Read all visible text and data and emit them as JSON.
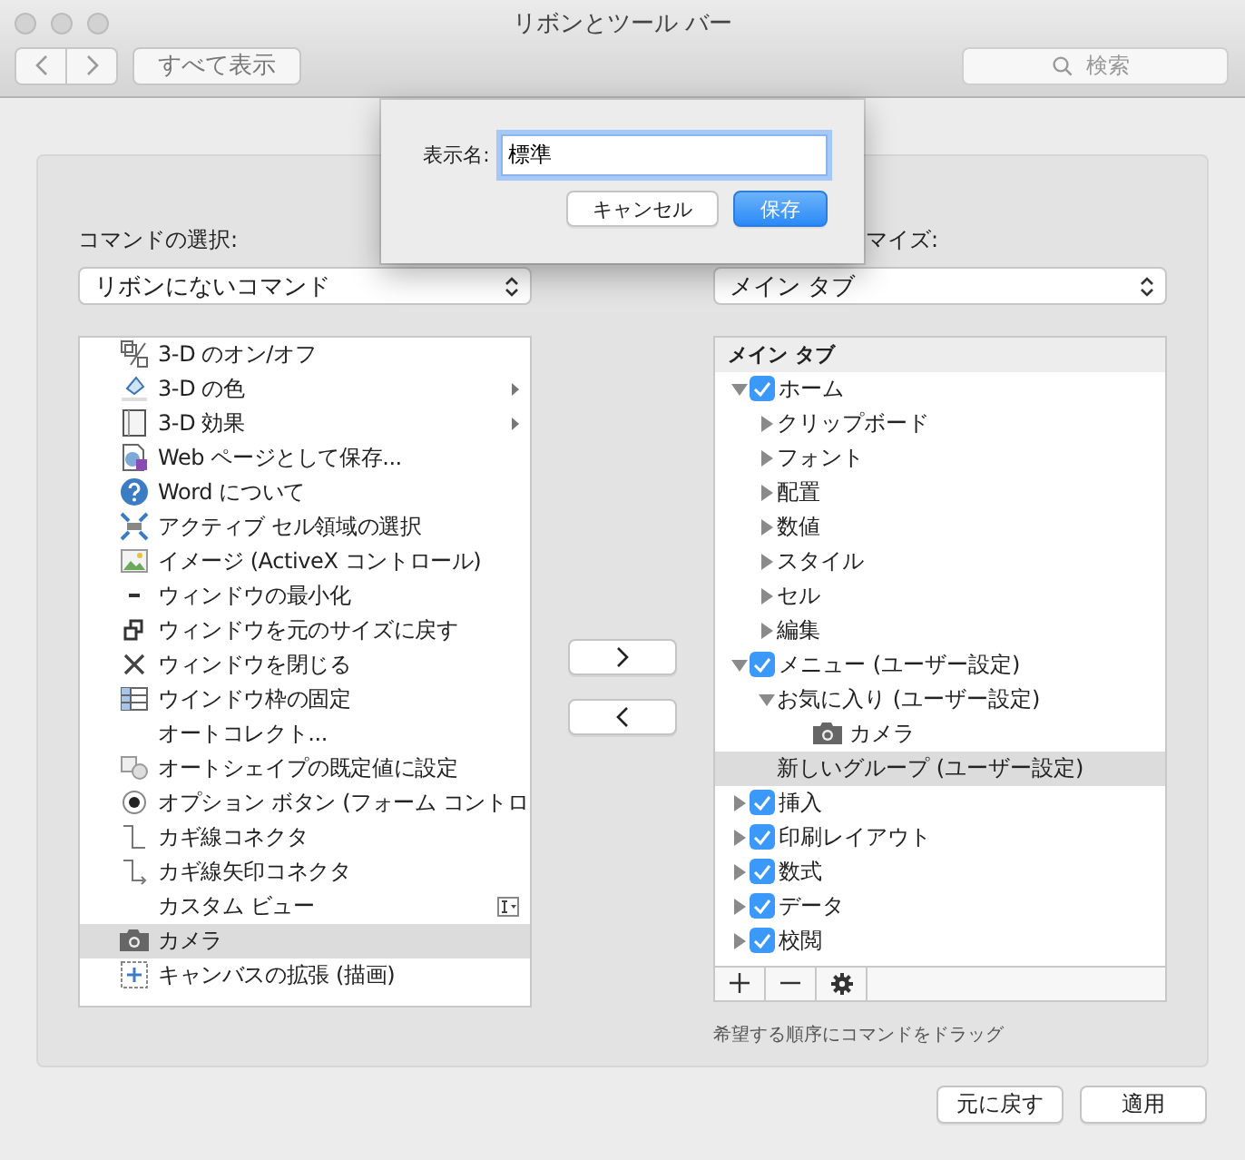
{
  "window": {
    "title": "リボンとツール バー"
  },
  "toolbar": {
    "show_all": "すべて表示",
    "search": {
      "placeholder": "検索"
    }
  },
  "commands": {
    "label": "コマンドの選択:",
    "dropdown": "リボンにないコマンド",
    "items": [
      {
        "label": "3-D のオン/オフ",
        "submenu": false,
        "selected": false
      },
      {
        "label": "3-D の色",
        "submenu": true,
        "selected": false
      },
      {
        "label": "3-D 効果",
        "submenu": true,
        "selected": false
      },
      {
        "label": "Web ページとして保存...",
        "submenu": false,
        "selected": false
      },
      {
        "label": "Word について",
        "submenu": false,
        "selected": false
      },
      {
        "label": "アクティブ セル領域の選択",
        "submenu": false,
        "selected": false
      },
      {
        "label": "イメージ (ActiveX コントロール)",
        "submenu": false,
        "selected": false
      },
      {
        "label": "ウィンドウの最小化",
        "submenu": false,
        "selected": false
      },
      {
        "label": "ウィンドウを元のサイズに戻す",
        "submenu": false,
        "selected": false
      },
      {
        "label": "ウィンドウを閉じる",
        "submenu": false,
        "selected": false
      },
      {
        "label": "ウインドウ枠の固定",
        "submenu": false,
        "selected": false
      },
      {
        "label": "オートコレクト...",
        "submenu": false,
        "selected": false
      },
      {
        "label": "オートシェイプの既定値に設定",
        "submenu": false,
        "selected": false
      },
      {
        "label": "オプション ボタン (フォーム コントロ",
        "submenu": false,
        "selected": false
      },
      {
        "label": "カギ線コネクタ",
        "submenu": false,
        "selected": false
      },
      {
        "label": "カギ線矢印コネクタ",
        "submenu": false,
        "selected": false
      },
      {
        "label": "カスタム ビュー",
        "submenu": false,
        "selected": false
      },
      {
        "label": "カメラ",
        "submenu": false,
        "selected": true
      },
      {
        "label": "キャンバスの拡張 (描画)",
        "submenu": false,
        "selected": false
      }
    ]
  },
  "customize": {
    "label": "マイズ:",
    "dropdown": "メイン タブ",
    "tree_header": "メイン タブ",
    "tree": [
      {
        "kind": "tab",
        "label": "ホーム",
        "checked": true,
        "expanded": true,
        "selected": false,
        "children": [
          {
            "kind": "group",
            "label": "クリップボード",
            "expanded": false,
            "selected": false
          },
          {
            "kind": "group",
            "label": "フォント",
            "expanded": false,
            "selected": false
          },
          {
            "kind": "group",
            "label": "配置",
            "expanded": false,
            "selected": false
          },
          {
            "kind": "group",
            "label": "数値",
            "expanded": false,
            "selected": false
          },
          {
            "kind": "group",
            "label": "スタイル",
            "expanded": false,
            "selected": false
          },
          {
            "kind": "group",
            "label": "セル",
            "expanded": false,
            "selected": false
          },
          {
            "kind": "group",
            "label": "編集",
            "expanded": false,
            "selected": false
          }
        ]
      },
      {
        "kind": "tab",
        "label": "メニュー (ユーザー設定)",
        "checked": true,
        "expanded": true,
        "selected": false,
        "children": [
          {
            "kind": "group",
            "label": "お気に入り (ユーザー設定)",
            "expanded": true,
            "selected": false,
            "children": [
              {
                "kind": "command",
                "label": "カメラ",
                "selected": false
              }
            ]
          },
          {
            "kind": "group",
            "label": "新しいグループ (ユーザー設定)",
            "selected": true
          }
        ]
      },
      {
        "kind": "tab",
        "label": "挿入",
        "checked": true,
        "expanded": false,
        "selected": false
      },
      {
        "kind": "tab",
        "label": "印刷レイアウト",
        "checked": true,
        "expanded": false,
        "selected": false
      },
      {
        "kind": "tab",
        "label": "数式",
        "checked": true,
        "expanded": false,
        "selected": false
      },
      {
        "kind": "tab",
        "label": "データ",
        "checked": true,
        "expanded": false,
        "selected": false
      },
      {
        "kind": "tab",
        "label": "校閲",
        "checked": true,
        "expanded": false,
        "selected": false
      }
    ],
    "hint": "希望する順序にコマンドをドラッグ"
  },
  "dialog": {
    "label": "表示名:",
    "value": "標準",
    "buttons": [
      {
        "label": "キャンセル",
        "default": false
      },
      {
        "label": "保存",
        "default": true
      }
    ]
  },
  "footer_buttons": [
    "元に戻す",
    "適用"
  ]
}
